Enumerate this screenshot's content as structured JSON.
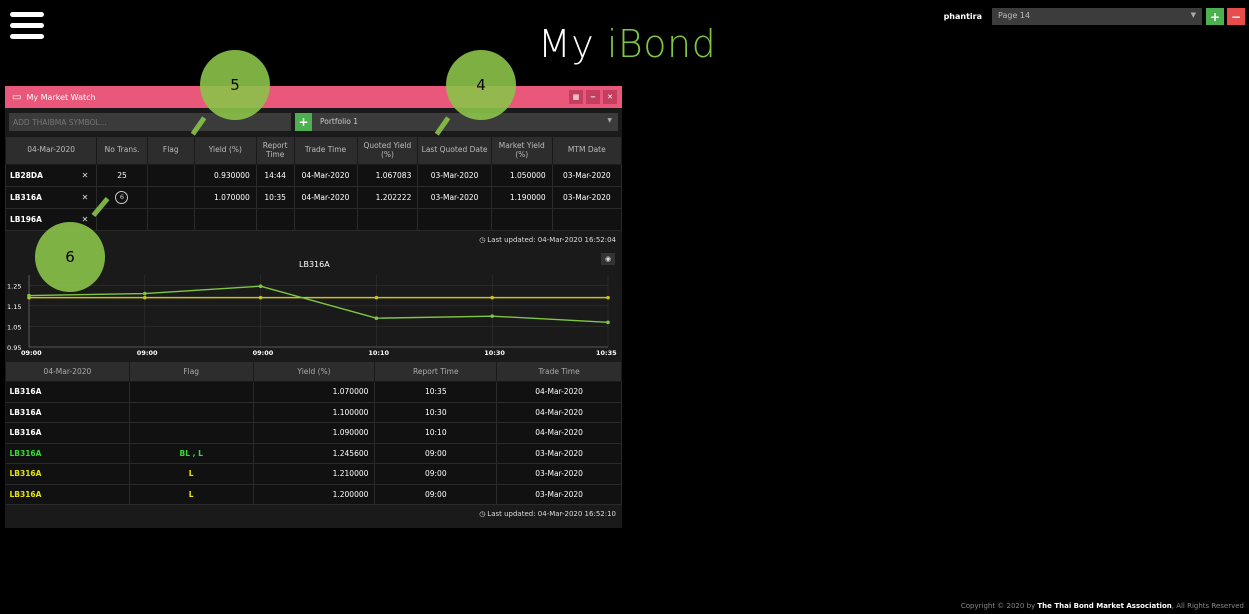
{
  "brand": {
    "my": "My ",
    "ibond": "iBond"
  },
  "topbar": {
    "username": "phantira",
    "page": "Page 14",
    "add": "+",
    "remove": "−"
  },
  "panel": {
    "title": "My Market Watch",
    "search_placeholder": "ADD THAIBMA SYMBOL...",
    "add": "+",
    "portfolio": "Portfolio 1",
    "header_btns": [
      "▦",
      "−",
      "✕"
    ]
  },
  "watch": {
    "headers": [
      "04-Mar-2020",
      "No Trans.",
      "Flag",
      "Yield (%)",
      "Report Time",
      "Trade Time",
      "Quoted Yield (%)",
      "Last Quoted Date",
      "Market Yield (%)",
      "MTM Date"
    ],
    "rows": [
      {
        "symbol": "LB28DA",
        "remove": "✕",
        "no_trans": "25",
        "flag": "",
        "yield": "0.930000",
        "report_time": "14:44",
        "trade_time": "04-Mar-2020",
        "quoted_yield": "1.067083",
        "last_quoted": "03-Mar-2020",
        "market_yield": "1.050000",
        "mtm_date": "03-Mar-2020"
      },
      {
        "symbol": "LB316A",
        "remove": "✕",
        "no_trans": "6",
        "flag": "",
        "yield": "1.070000",
        "report_time": "10:35",
        "trade_time": "04-Mar-2020",
        "quoted_yield": "1.202222",
        "last_quoted": "03-Mar-2020",
        "market_yield": "1.190000",
        "mtm_date": "03-Mar-2020"
      },
      {
        "symbol": "LB196A",
        "remove": "✕",
        "no_trans": "",
        "flag": "",
        "yield": "",
        "report_time": "",
        "trade_time": "",
        "quoted_yield": "",
        "last_quoted": "",
        "market_yield": "",
        "mtm_date": ""
      }
    ],
    "updated": "Last updated: 04-Mar-2020 16:52:04"
  },
  "chart_data": {
    "type": "line",
    "title": "LB316A",
    "x": [
      "09:00",
      "09:00",
      "09:00",
      "10:10",
      "10:30",
      "10:35"
    ],
    "series": [
      {
        "values": [
          1.2,
          1.21,
          1.2456,
          1.09,
          1.1,
          1.07
        ],
        "color": "#7fc742"
      },
      {
        "values": [
          1.19,
          1.19,
          1.19,
          1.19,
          1.19,
          1.19
        ],
        "color": "#c9c21c"
      }
    ],
    "yticks": [
      "0.95",
      "1.05",
      "1.15",
      "1.25"
    ],
    "ylim": [
      0.95,
      1.3
    ],
    "grid": true
  },
  "transactions": {
    "headers": [
      "04-Mar-2020",
      "Flag",
      "Yield (%)",
      "Report Time",
      "Trade Time"
    ],
    "rows": [
      {
        "symbol": "LB316A",
        "flag": "",
        "yield": "1.070000",
        "report_time": "10:35",
        "trade_time": "04-Mar-2020",
        "tone": "white"
      },
      {
        "symbol": "LB316A",
        "flag": "",
        "yield": "1.100000",
        "report_time": "10:30",
        "trade_time": "04-Mar-2020",
        "tone": "white"
      },
      {
        "symbol": "LB316A",
        "flag": "",
        "yield": "1.090000",
        "report_time": "10:10",
        "trade_time": "04-Mar-2020",
        "tone": "white"
      },
      {
        "symbol": "LB316A",
        "flag": "BL , L",
        "yield": "1.245600",
        "report_time": "09:00",
        "trade_time": "03-Mar-2020",
        "tone": "green"
      },
      {
        "symbol": "LB316A",
        "flag": "L",
        "yield": "1.210000",
        "report_time": "09:00",
        "trade_time": "03-Mar-2020",
        "tone": "yellow"
      },
      {
        "symbol": "LB316A",
        "flag": "L",
        "yield": "1.200000",
        "report_time": "09:00",
        "trade_time": "03-Mar-2020",
        "tone": "yellow"
      }
    ],
    "updated": "Last updated: 04-Mar-2020 16:52:10"
  },
  "callouts": [
    "5",
    "4",
    "6"
  ],
  "copyright": {
    "prefix": "Copyright © 2020 by ",
    "org": "The Thai Bond Market Association",
    "suffix": ", All Rights Reserved"
  }
}
